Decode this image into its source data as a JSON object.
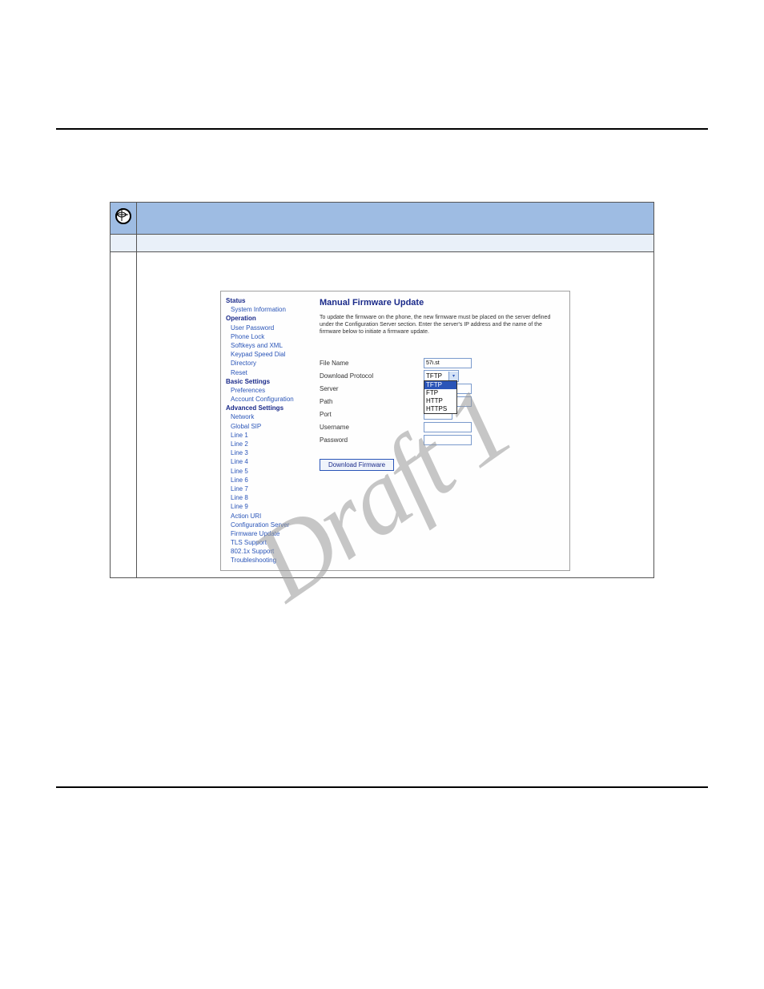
{
  "watermark": "Draft 1",
  "sidebar": {
    "headers": {
      "status": "Status",
      "operation": "Operation",
      "basic": "Basic Settings",
      "advanced": "Advanced Settings"
    },
    "status_items": [
      "System Information"
    ],
    "operation_items": [
      "User Password",
      "Phone Lock",
      "Softkeys and XML",
      "Keypad Speed Dial",
      "Directory",
      "Reset"
    ],
    "basic_items": [
      "Preferences",
      "Account Configuration"
    ],
    "advanced_items": [
      "Network",
      "Global SIP",
      "Line 1",
      "Line 2",
      "Line 3",
      "Line 4",
      "Line 5",
      "Line 6",
      "Line 7",
      "Line 8",
      "Line 9",
      "Action URI",
      "Configuration Server",
      "Firmware Update",
      "TLS Support",
      "802.1x Support",
      "Troubleshooting"
    ]
  },
  "main": {
    "title": "Manual Firmware Update",
    "desc": "To update the firmware on the phone, the new firmware must be placed on the server defined under the Configuration Server section. Enter the server's IP address and the name of the firmware below to initiate a firmware update.",
    "fields": {
      "file_name": {
        "label": "File Name",
        "value": "57i.st"
      },
      "protocol": {
        "label": "Download Protocol",
        "selected": "TFTP",
        "options": [
          "TFTP",
          "FTP",
          "HTTP",
          "HTTPS"
        ]
      },
      "server": {
        "label": "Server",
        "value": ""
      },
      "path": {
        "label": "Path",
        "value": ""
      },
      "port": {
        "label": "Port",
        "value": ""
      },
      "username": {
        "label": "Username",
        "value": ""
      },
      "password": {
        "label": "Password",
        "value": ""
      }
    },
    "button": "Download Firmware"
  }
}
